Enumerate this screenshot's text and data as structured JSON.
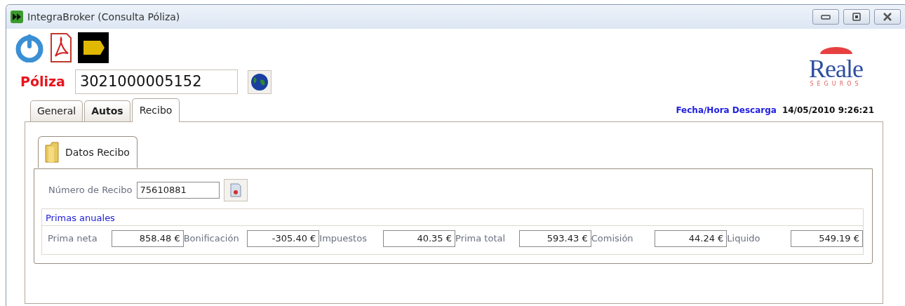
{
  "window": {
    "title": "IntegraBroker (Consulta Póliza)"
  },
  "logo": {
    "name": "Reale",
    "tagline": "SEGUROS"
  },
  "poliza": {
    "label": "Póliza",
    "value": "3021000005152"
  },
  "download": {
    "label": "Fecha/Hora Descarga",
    "value": "14/05/2010 9:26:21"
  },
  "tabs": [
    {
      "label": "General",
      "selected": false,
      "bold": false
    },
    {
      "label": "Autos",
      "selected": false,
      "bold": true
    },
    {
      "label": "Recibo",
      "selected": true,
      "bold": false
    }
  ],
  "subtabs": [
    {
      "label": "Datos Recibo",
      "selected": true
    }
  ],
  "recibo": {
    "label": "Número de Recibo",
    "value": "75610881"
  },
  "primas": {
    "title": "Primas anuales",
    "fields": [
      {
        "label": "Prima neta",
        "value": "858.48 €"
      },
      {
        "label": "Bonificación",
        "value": "-305.40 €"
      },
      {
        "label": "Impuestos",
        "value": "40.35 €"
      },
      {
        "label": "Prima total",
        "value": "593.43 €"
      },
      {
        "label": "Comisión",
        "value": "44.24 €"
      },
      {
        "label": "Liquido",
        "value": "549.19 €"
      }
    ]
  }
}
